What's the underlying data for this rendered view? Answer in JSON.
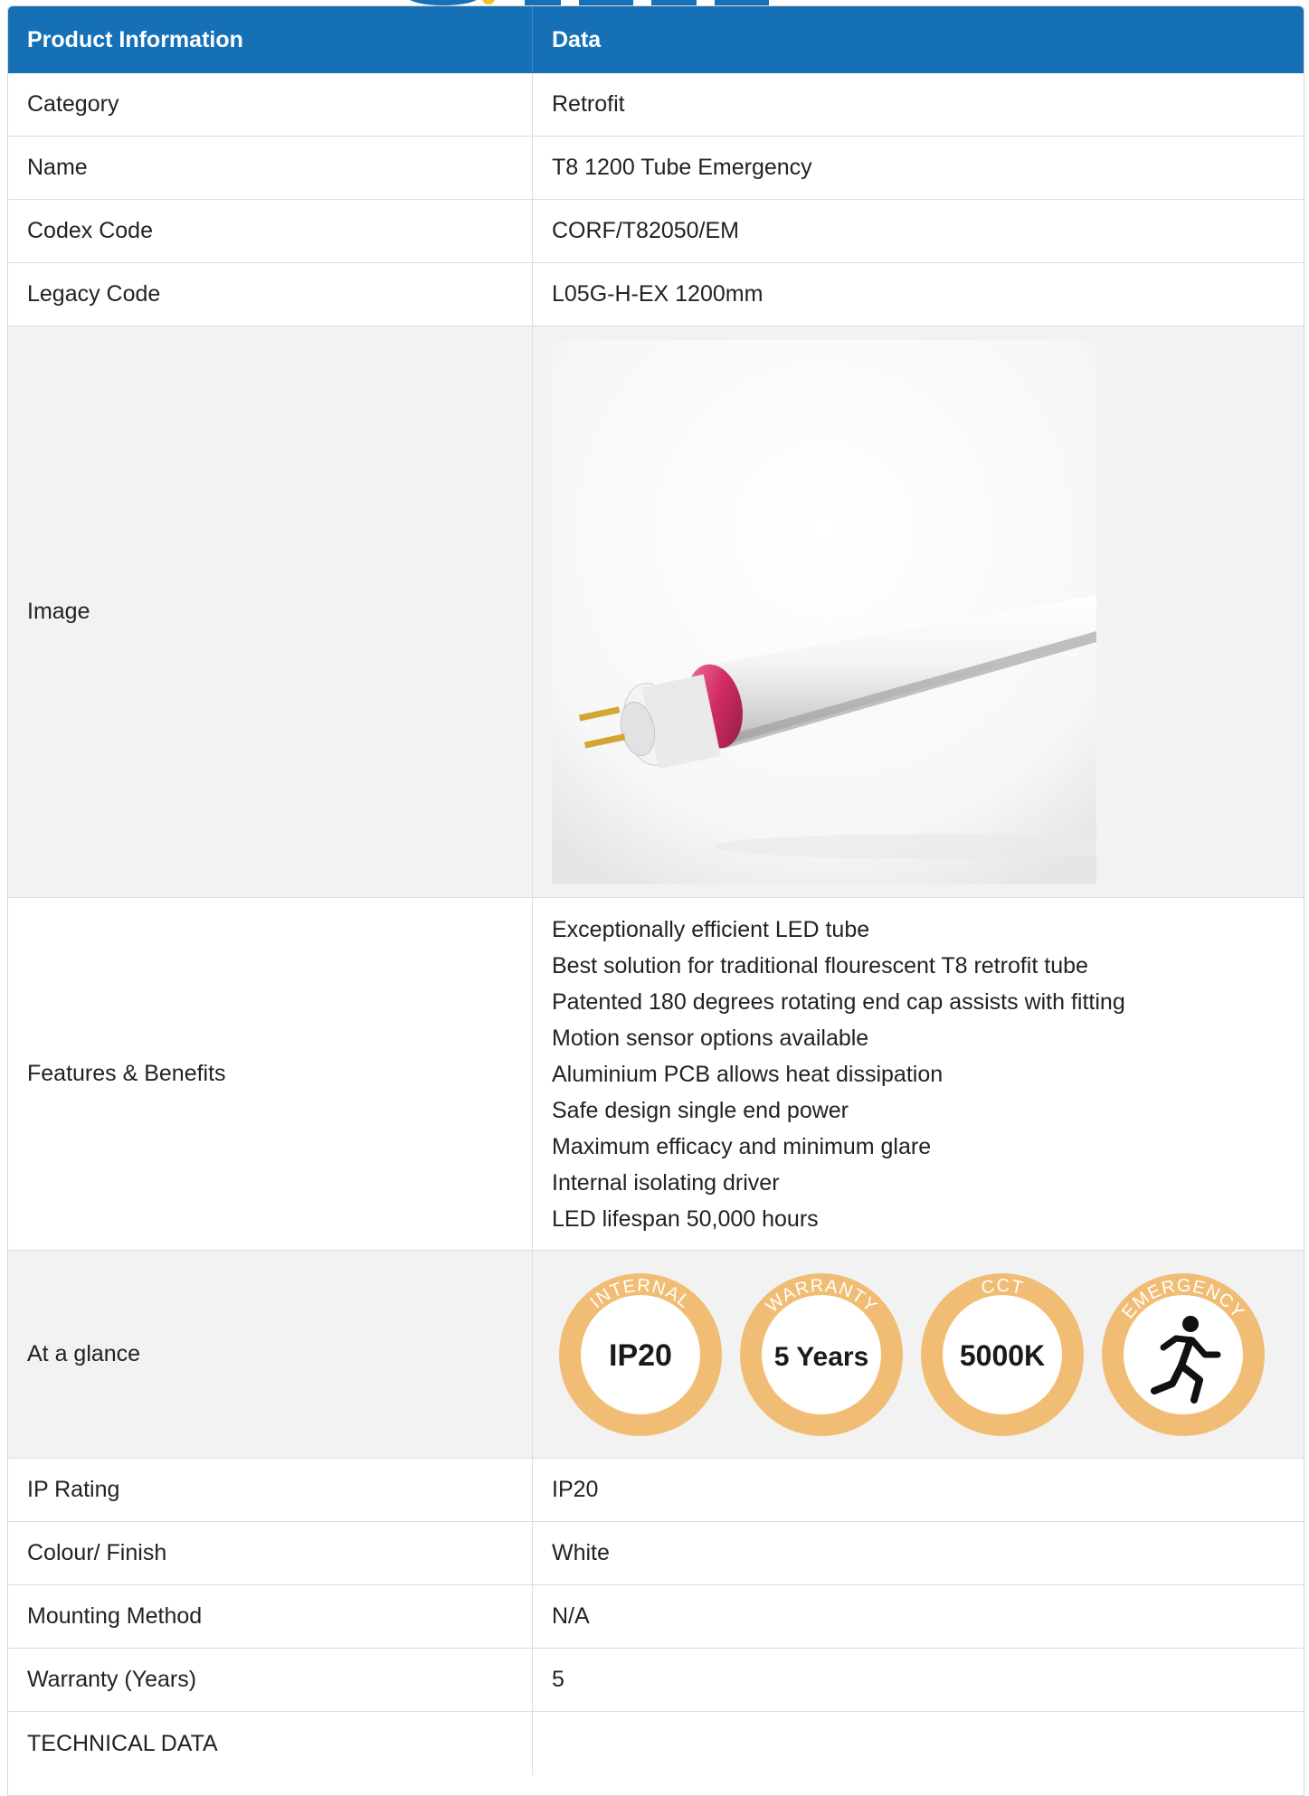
{
  "table": {
    "header": {
      "col1": "Product Information",
      "col2": "Data"
    },
    "rows": {
      "category": {
        "label": "Category",
        "value": "Retrofit"
      },
      "name": {
        "label": "Name",
        "value": "T8 1200 Tube Emergency"
      },
      "codex": {
        "label": "Codex Code",
        "value": "CORF/T82050/EM"
      },
      "legacy": {
        "label": "Legacy Code",
        "value": "L05G-H-EX 1200mm"
      },
      "image": {
        "label": "Image"
      },
      "features": {
        "label": "Features & Benefits",
        "items": [
          "Exceptionally efficient LED tube",
          "Best solution for traditional flourescent T8 retrofit tube",
          "Patented 180 degrees rotating end cap assists with fitting",
          "Motion sensor options available",
          "Aluminium PCB allows heat dissipation",
          "Safe design single end power",
          "Maximum efficacy and minimum glare",
          "Internal isolating driver",
          "LED lifespan 50,000 hours"
        ]
      },
      "glance": {
        "label": "At a glance",
        "badges": [
          {
            "arc": "INTERNAL",
            "center": "IP20"
          },
          {
            "arc": "WARRANTY",
            "center": "5 Years"
          },
          {
            "arc": "CCT",
            "center": "5000K"
          },
          {
            "arc": "EMERGENCY",
            "icon": "running-man-icon"
          }
        ]
      },
      "ip": {
        "label": "IP Rating",
        "value": "IP20"
      },
      "colour": {
        "label": "Colour/ Finish",
        "value": "White"
      },
      "mounting": {
        "label": "Mounting Method",
        "value": "N/A"
      },
      "warranty": {
        "label": "Warranty (Years)",
        "value": "5"
      },
      "technical": {
        "label": "TECHNICAL DATA"
      }
    }
  },
  "colors": {
    "header_bg": "#1670b5",
    "badge_ring": "#f1bd74",
    "end_cap": "#d02c63"
  }
}
